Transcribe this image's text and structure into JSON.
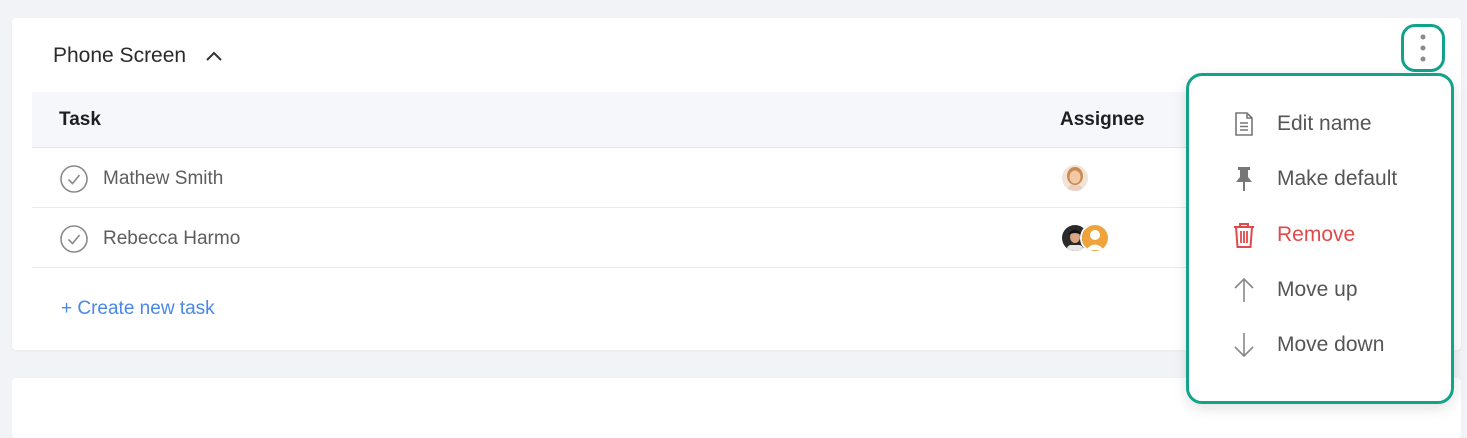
{
  "section": {
    "title": "Phone Screen",
    "expanded": true
  },
  "table": {
    "headers": {
      "task": "Task",
      "assignee": "Assignee"
    },
    "rows": [
      {
        "name": "Mathew Smith",
        "assignees": [
          "avatar-woman"
        ]
      },
      {
        "name": "Rebecca Harmo",
        "assignees": [
          "avatar-man",
          "avatar-user-placeholder"
        ]
      }
    ]
  },
  "create_task_label": "+ Create new task",
  "next_section_title": "",
  "menu": {
    "items": [
      {
        "label": "Edit name",
        "icon": "document-icon"
      },
      {
        "label": "Make default",
        "icon": "pin-icon"
      },
      {
        "label": "Remove",
        "icon": "trash-icon",
        "style": "danger"
      },
      {
        "label": "Move up",
        "icon": "arrow-up-icon"
      },
      {
        "label": "Move down",
        "icon": "arrow-down-icon"
      }
    ]
  },
  "colors": {
    "accent_highlight": "#12a38a",
    "link": "#4a87e8",
    "danger": "#e14a4a"
  }
}
